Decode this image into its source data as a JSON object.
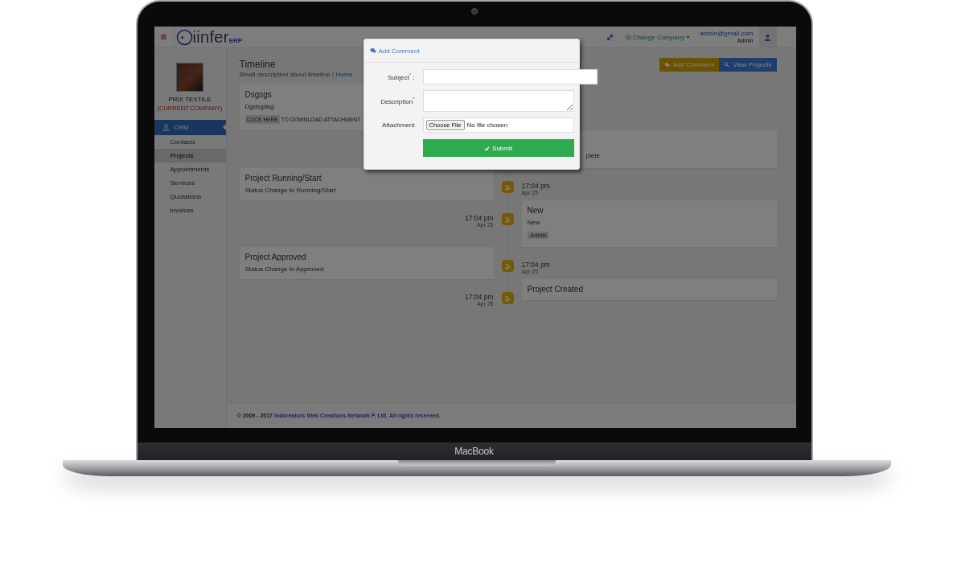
{
  "device": {
    "brand": "MacBook"
  },
  "header": {
    "logo": {
      "name": "iinfer",
      "suffix": "ERP"
    },
    "change_company": "Change Company",
    "user_email": "admin@gmail.com",
    "user_role": "Admin"
  },
  "sidebar": {
    "company": "PRIX TEXTILE",
    "company_note": "(CURRENT COMPANY)",
    "section": {
      "label": "CRM",
      "selected": true
    },
    "items": [
      {
        "label": "Contacts",
        "selected": false
      },
      {
        "label": "Projects",
        "selected": true
      },
      {
        "label": "Appointments",
        "selected": false
      },
      {
        "label": "Services",
        "selected": false
      },
      {
        "label": "Quotations",
        "selected": false
      },
      {
        "label": "Invoices",
        "selected": false
      }
    ]
  },
  "page": {
    "title": "Timeline",
    "description": "Small description about timeline /",
    "breadcrumb": "Home",
    "actions": [
      {
        "label": "Add Comment",
        "kind": "comment"
      },
      {
        "label": "View Projects",
        "kind": "search"
      }
    ]
  },
  "timeline": [
    {
      "kind": "left",
      "title": "Dsgsgs",
      "body": "Dgdsgdsg",
      "attachment_button": "CLICK HERE",
      "attachment_text": "TO DOWNLOAD ATTACHMENT"
    },
    {
      "kind": "covered_right",
      "body": "plete"
    },
    {
      "kind": "left",
      "title": "Project Running/Start",
      "body": "Status Change to Running/Start",
      "time": "17:04 pm",
      "date": "Apr 25"
    },
    {
      "kind": "right",
      "title": "New",
      "body": "New",
      "author": "-Admin",
      "time": "17:04 pm",
      "date": "Apr 25"
    },
    {
      "kind": "left",
      "title": "Project Approved",
      "body": "Status Change to Approved",
      "time": "17:04 pm",
      "date": "Apr 25"
    },
    {
      "kind": "right",
      "title": "Project Created",
      "time": "17:04 pm",
      "date": "Apr 25"
    }
  ],
  "footer": {
    "copyright": "© 2009 - 2017",
    "company_link": "Indoreators Web Creations Network P. Ltd. All rights reserved."
  },
  "modal": {
    "title": "Add Comment",
    "fields": [
      {
        "label": "Subject$^{*}$ :",
        "kind": "text"
      },
      {
        "label": "Description$^{*}$",
        "kind": "textarea"
      },
      {
        "label": "Attachment",
        "kind": "file",
        "button": "Choose File",
        "value": "No file chosen"
      }
    ],
    "submit": "Submit"
  }
}
